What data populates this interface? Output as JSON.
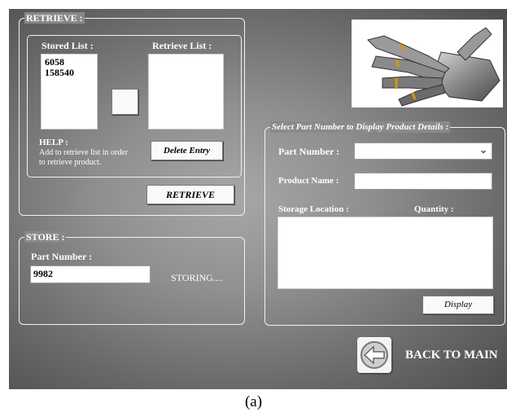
{
  "retrieve": {
    "title": "RETRIEVE :",
    "stored_list_label": "Stored List :",
    "retrieve_list_label": "Retrieve List :",
    "stored_items": [
      "6058",
      "158540"
    ],
    "help_title": "HELP :",
    "help_text_line1": "Add to retrieve list in order",
    "help_text_line2": "to retrieve product.",
    "delete_entry_label": "Delete Entry",
    "retrieve_button_label": "RETRIEVE"
  },
  "store": {
    "title": "STORE :",
    "part_number_label": "Part Number :",
    "part_number_value": "9982",
    "status_text": "STORING...."
  },
  "details": {
    "title": "Select Part Number to Display Product Details :",
    "part_number_label": "Part Number :",
    "product_name_label": "Product Name :",
    "storage_location_label": "Storage Location :",
    "quantity_label": "Quantity :",
    "display_button_label": "Display"
  },
  "back_to_main_label": "BACK TO MAIN",
  "caption": "(a)"
}
